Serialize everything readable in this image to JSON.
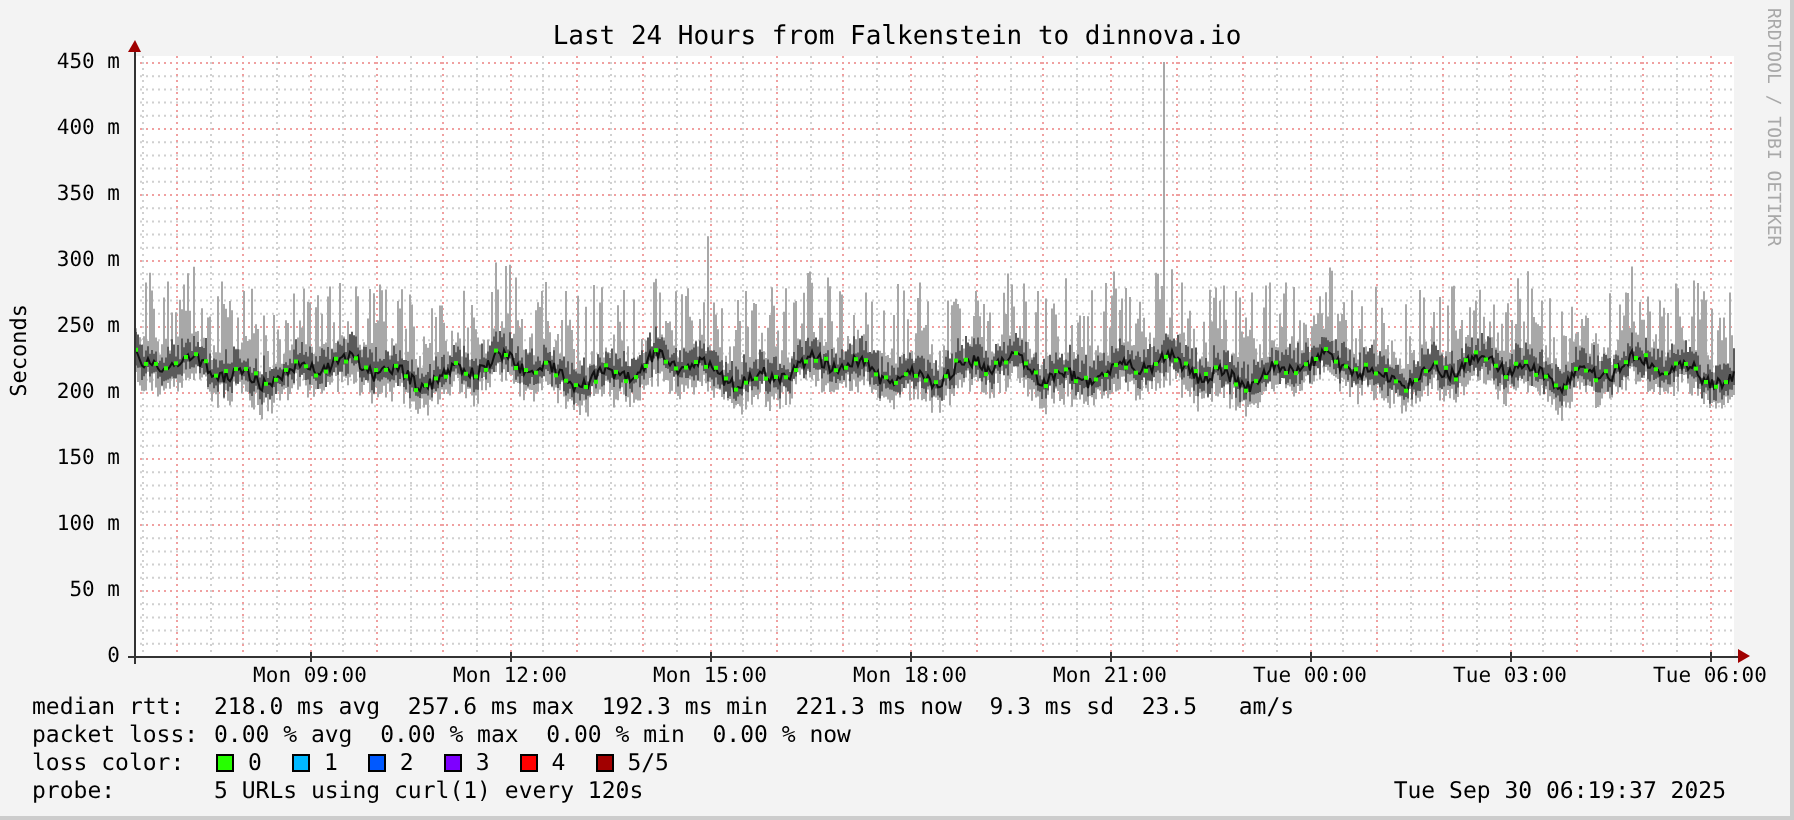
{
  "title": "Last 24 Hours from Falkenstein to dinnova.io",
  "ylabel": "Seconds",
  "credit": "RRDTOOL / TOBI OETIKER",
  "y_ticks": [
    "450 m",
    "400 m",
    "350 m",
    "300 m",
    "250 m",
    "200 m",
    "150 m",
    "100 m",
    "50 m",
    "0"
  ],
  "x_ticks": [
    "Mon 09:00",
    "Mon 12:00",
    "Mon 15:00",
    "Mon 18:00",
    "Mon 21:00",
    "Tue 00:00",
    "Tue 03:00",
    "Tue 06:00"
  ],
  "legend": {
    "median_rtt": {
      "label": "median rtt:",
      "text": "218.0 ms avg  257.6 ms max  192.3 ms min  221.3 ms now  9.3 ms sd  23.5   am/s"
    },
    "packet_loss": {
      "label": "packet loss:",
      "text": "0.00 % avg  0.00 % max  0.00 % min  0.00 % now"
    },
    "loss_color": {
      "label": "loss color:",
      "items": [
        {
          "label": "0",
          "color": "#26ff00"
        },
        {
          "label": "1",
          "color": "#00b8ff"
        },
        {
          "label": "2",
          "color": "#0059ff"
        },
        {
          "label": "3",
          "color": "#7e00ff"
        },
        {
          "label": "4",
          "color": "#ff0000"
        },
        {
          "label": "5/5",
          "color": "#a10000"
        }
      ]
    },
    "probe": {
      "label": "probe:",
      "text": "5 URLs using curl(1) every 120s"
    }
  },
  "timestamp": "Tue Sep 30 06:19:37 2025"
}
